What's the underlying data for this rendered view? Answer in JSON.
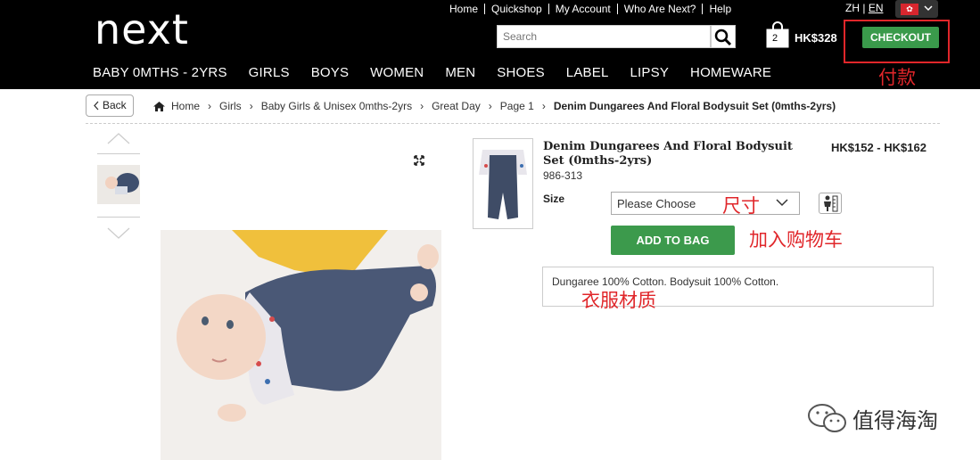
{
  "header": {
    "logo": "next",
    "top_links": [
      "Home",
      "Quickshop",
      "My Account",
      "Who Are Next?",
      "Help"
    ],
    "lang_zh": "ZH",
    "lang_sep": "|",
    "lang_en": "EN",
    "search_placeholder": "Search",
    "bag_count": "2",
    "bag_total": "HK$328",
    "checkout_label": "CHECKOUT"
  },
  "nav": [
    "BABY 0MTHS - 2YRS",
    "GIRLS",
    "BOYS",
    "WOMEN",
    "MEN",
    "SHOES",
    "LABEL",
    "LIPSY",
    "HOMEWARE"
  ],
  "breadcrumb": {
    "back_label": "Back",
    "items": [
      "Home",
      "Girls",
      "Baby Girls & Unisex 0mths-2yrs",
      "Great Day",
      "Page 1"
    ],
    "current": "Denim Dungarees And Floral Bodysuit Set (0mths-2yrs)"
  },
  "product": {
    "title": "Denim Dungarees And Floral Bodysuit Set (0mths-2yrs)",
    "code": "986-313",
    "price": "HK$152 - HK$162",
    "size_label": "Size",
    "size_placeholder": "Please Choose",
    "add_to_bag": "ADD TO BAG",
    "description": "Dungaree 100% Cotton. Bodysuit 100% Cotton."
  },
  "annotations": {
    "checkout": "付款",
    "size": "尺寸",
    "add_to_bag": "加入购物车",
    "material": "衣服材质",
    "color": "#e0262a"
  },
  "watermark": "值得海淘",
  "colors": {
    "header_bg": "#000000",
    "button_green": "#3c9a4c"
  }
}
